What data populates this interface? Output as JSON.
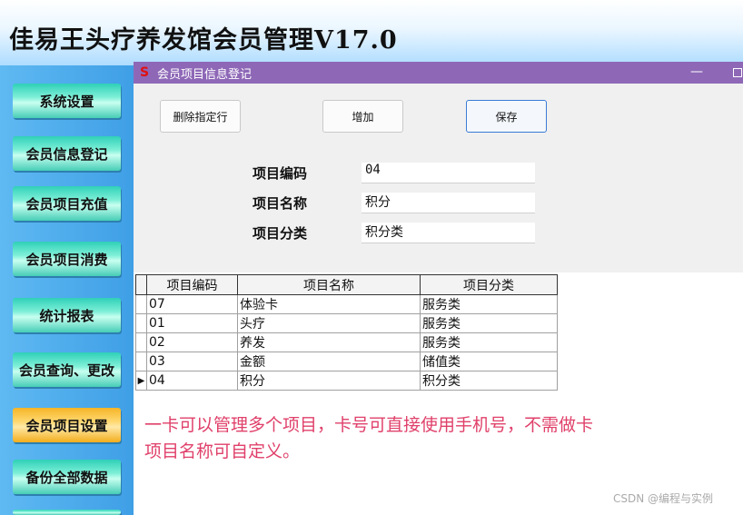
{
  "app": {
    "title": "佳易王头疗养发馆会员管理V17.0"
  },
  "sidebar": {
    "items": [
      {
        "label": "系统设置"
      },
      {
        "label": "会员信息登记"
      },
      {
        "label": "会员项目充值"
      },
      {
        "label": "会员项目消费"
      },
      {
        "label": "统计报表"
      },
      {
        "label": "会员查询、更改"
      },
      {
        "label": "会员项目设置",
        "active": true
      },
      {
        "label": "备份全部数据"
      }
    ]
  },
  "window": {
    "title": "会员项目信息登记",
    "minimize_glyph": "—",
    "logo_glyph": "S"
  },
  "toolbar": {
    "delete_label": "删除指定行",
    "add_label": "增加",
    "save_label": "保存"
  },
  "form": {
    "code_label": "项目编码",
    "code_value": "04",
    "name_label": "项目名称",
    "name_value": "积分",
    "category_label": "项目分类",
    "category_value": "积分类"
  },
  "grid": {
    "columns": [
      "项目编码",
      "项目名称",
      "项目分类"
    ],
    "current_row_marker": "▶",
    "rows": [
      [
        "07",
        "体验卡",
        "服务类"
      ],
      [
        "01",
        "头疗",
        "服务类"
      ],
      [
        "02",
        "养发",
        "服务类"
      ],
      [
        "03",
        "金额",
        "储值类"
      ],
      [
        "04",
        "积分",
        "积分类"
      ]
    ]
  },
  "note": {
    "line1": "一卡可以管理多个项目，卡号可直接使用手机号，不需做卡",
    "line2": "项目名称可自定义。"
  },
  "watermark": "CSDN @编程与实例",
  "colors": {
    "titlebar": "#8e68b7",
    "note_text": "#e0406a",
    "sidebar_button": "#2fd0b8",
    "sidebar_active": "#f5b526"
  }
}
